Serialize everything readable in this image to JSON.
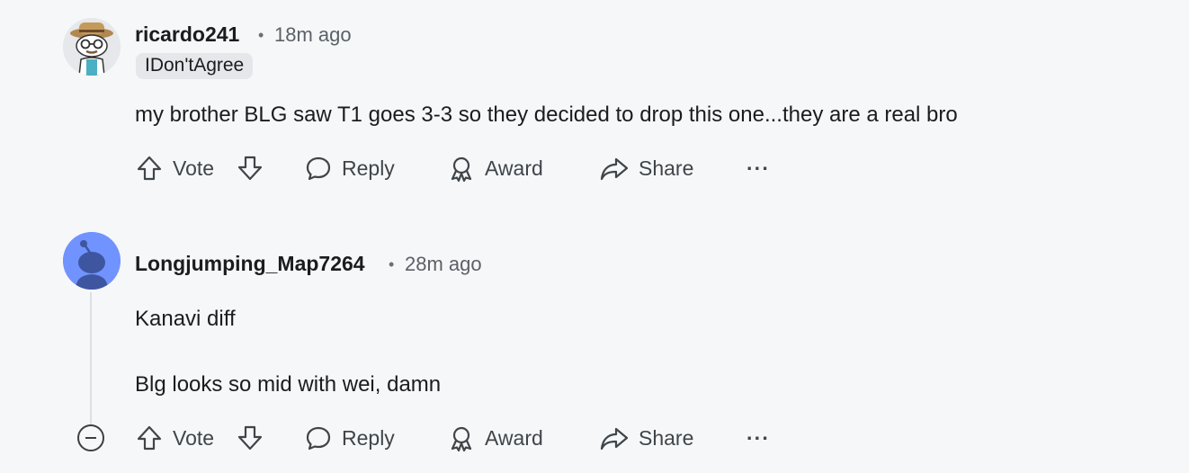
{
  "comments": [
    {
      "username": "ricardo241",
      "separator": "•",
      "time": "18m ago",
      "flair": "IDon'tAgree",
      "lines": [
        "my brother BLG saw T1 goes 3-3 so they decided to drop this one...they are a real bro"
      ],
      "actions": {
        "vote": "Vote",
        "reply": "Reply",
        "award": "Award",
        "share": "Share",
        "more": "···"
      }
    },
    {
      "username": "Longjumping_Map7264",
      "separator": "•",
      "time": "28m ago",
      "lines": [
        "Kanavi diff",
        "Blg looks so mid with wei, damn"
      ],
      "actions": {
        "vote": "Vote",
        "reply": "Reply",
        "award": "Award",
        "share": "Share",
        "more": "···"
      }
    }
  ],
  "icons": [
    "upvote-icon",
    "downvote-icon",
    "comment-bubble-icon",
    "award-icon",
    "share-arrow-icon",
    "more-options-icon",
    "collapse-thread-icon"
  ],
  "colors": {
    "background": "#f6f7f9",
    "default_avatar": "#7193ff",
    "flair_bg": "#e5e7ea"
  }
}
